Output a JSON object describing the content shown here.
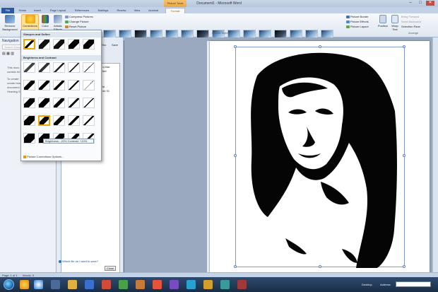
{
  "window": {
    "title": "Document1 - Microsoft Word",
    "minimize": "–",
    "maximize": "□",
    "close": "✕"
  },
  "context_tab": "Picture Tools",
  "tabs": [
    "File",
    "Home",
    "Insert",
    "Page Layout",
    "References",
    "Mailings",
    "Review",
    "View",
    "Acrobat",
    "Format"
  ],
  "ribbon": {
    "remove_background": "Remove Background",
    "corrections": "Corrections",
    "color": "Color",
    "artistic_effects": "Artistic Effects",
    "compress_pictures": "Compress Pictures",
    "change_picture": "Change Picture",
    "reset_picture": "Reset Picture",
    "picture_border": "Picture Border",
    "picture_effects": "Picture Effects",
    "picture_layout": "Picture Layout",
    "position": "Position",
    "wrap_text": "Wrap Text",
    "bring_forward": "Bring Forward",
    "send_backward": "Send Backward",
    "selection_pane": "Selection Pane",
    "picture_styles_label": "Picture Styles",
    "arrange_label": "Arrange"
  },
  "navigation": {
    "title": "Navigation",
    "search_placeholder": "Search Docum",
    "text_lines": [
      "This docu",
      "contain he",
      "To create",
      "create hea",
      "document",
      "Heading S"
    ]
  },
  "center_panel": {
    "cols": [
      "Rho",
      "Save"
    ],
    "frag_lines": [
      "x-Mar.",
      "bet",
      "te ..",
      "ne 31"
    ],
    "which_file": "Which file do I want to save?",
    "close": "Close"
  },
  "corrections_menu": {
    "sharpen_header": "Sharpen and Soften",
    "brightness_header": "Brightness and Contrast",
    "tooltip": "Brightness: -20% Contrast: +20%",
    "options": "Picture Corrections Options..."
  },
  "statusbar": {
    "page": "Page: 1 of 1",
    "words": "Words: 0"
  },
  "taskbar": {
    "desktop": "Desktop",
    "address": "Address"
  },
  "colors": {
    "ribbon_tab_blue": "#2a5aa5",
    "context_orange": "#e9a64a",
    "selection_gold": "#f0a800"
  }
}
